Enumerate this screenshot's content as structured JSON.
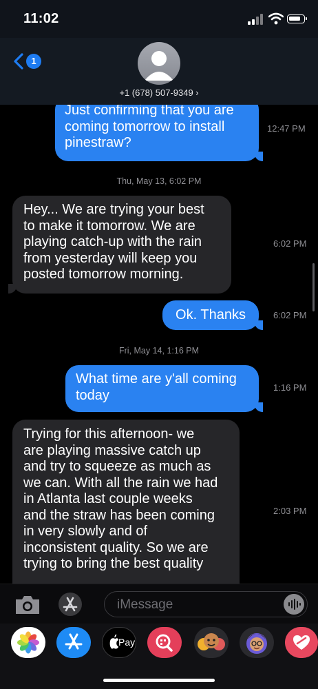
{
  "status_bar": {
    "time": "11:02"
  },
  "header": {
    "back_count": "1",
    "contact": "+1 (678) 507-9349 ›"
  },
  "messages": [
    {
      "direction": "outgoing",
      "lines": [
        "Just confirming that you are",
        "coming tomorrow to install",
        "pinestraw?"
      ],
      "time": "12:47 PM"
    },
    {
      "divider": "Thu, May 13, 6:02 PM"
    },
    {
      "direction": "incoming",
      "lines": [
        "Hey... We are trying your best",
        "to make it tomorrow. We are",
        "playing catch-up with the rain",
        "from yesterday will keep you",
        "posted tomorrow morning."
      ],
      "time": "6:02 PM"
    },
    {
      "direction": "outgoing",
      "lines": [
        "Ok. Thanks"
      ],
      "time": "6:02 PM"
    },
    {
      "divider": "Fri, May 14, 1:16 PM"
    },
    {
      "direction": "outgoing",
      "lines": [
        "What time are y'all coming",
        "today"
      ],
      "time": "1:16 PM"
    },
    {
      "direction": "incoming",
      "lines": [
        "Trying for this afternoon- we",
        "are playing massive catch up",
        "and try to squeeze as much as",
        "we can. With all the rain we had",
        "in Atlanta last couple weeks",
        "and the  straw has been coming",
        "in very slowly and of",
        "inconsistent quality. So we are",
        "trying to bring the best quality"
      ],
      "time": "2:03 PM"
    }
  ],
  "input": {
    "placeholder": "iMessage"
  },
  "app_drawer": {
    "apple_pay_label": "Pay"
  },
  "colors": {
    "outgoing_bubble": "#2a82f1",
    "incoming_bubble": "#262629",
    "accent": "#1e7cf2"
  },
  "icons": [
    "signal-icon",
    "wifi-icon",
    "battery-icon",
    "back-chevron-icon",
    "avatar-icon",
    "camera-icon",
    "appstore-icon",
    "audio-input-icon",
    "photos-icon",
    "apple-pay-icon",
    "search-images-icon",
    "memoji-icon",
    "digital-touch-icon"
  ]
}
